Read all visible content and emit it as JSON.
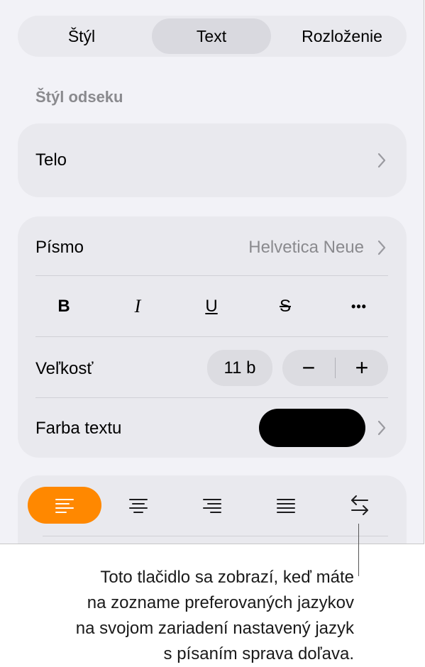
{
  "tabs": [
    {
      "label": "Štýl",
      "selected": false
    },
    {
      "label": "Text",
      "selected": true
    },
    {
      "label": "Rozloženie",
      "selected": false
    }
  ],
  "paragraph_style": {
    "header": "Štýl odseku",
    "value": "Telo"
  },
  "font": {
    "label": "Písmo",
    "value": "Helvetica Neue"
  },
  "format_buttons": [
    {
      "label": "B",
      "icon": "bold-icon"
    },
    {
      "label": "I",
      "icon": "italic-icon"
    },
    {
      "label": "U",
      "icon": "underline-icon"
    },
    {
      "label": "S",
      "icon": "strikethrough-icon"
    },
    {
      "label": "•••",
      "icon": "more-options-icon"
    }
  ],
  "size": {
    "label": "Veľkosť",
    "value": "11 b",
    "decrement": "−",
    "increment": "+"
  },
  "text_color": {
    "label": "Farba textu",
    "color": "#000000"
  },
  "alignment": {
    "buttons": [
      "align-left-icon",
      "align-center-icon",
      "align-right-icon",
      "align-justify-icon",
      "text-direction-icon"
    ],
    "active_index": 0,
    "active_color": "#ff8800"
  },
  "callout": {
    "lines": [
      "Toto tlačidlo sa zobrazí, keď máte",
      "na zozname preferovaných jazykov",
      "na svojom zariadení nastavený jazyk",
      "s písaním sprava doľava."
    ]
  }
}
